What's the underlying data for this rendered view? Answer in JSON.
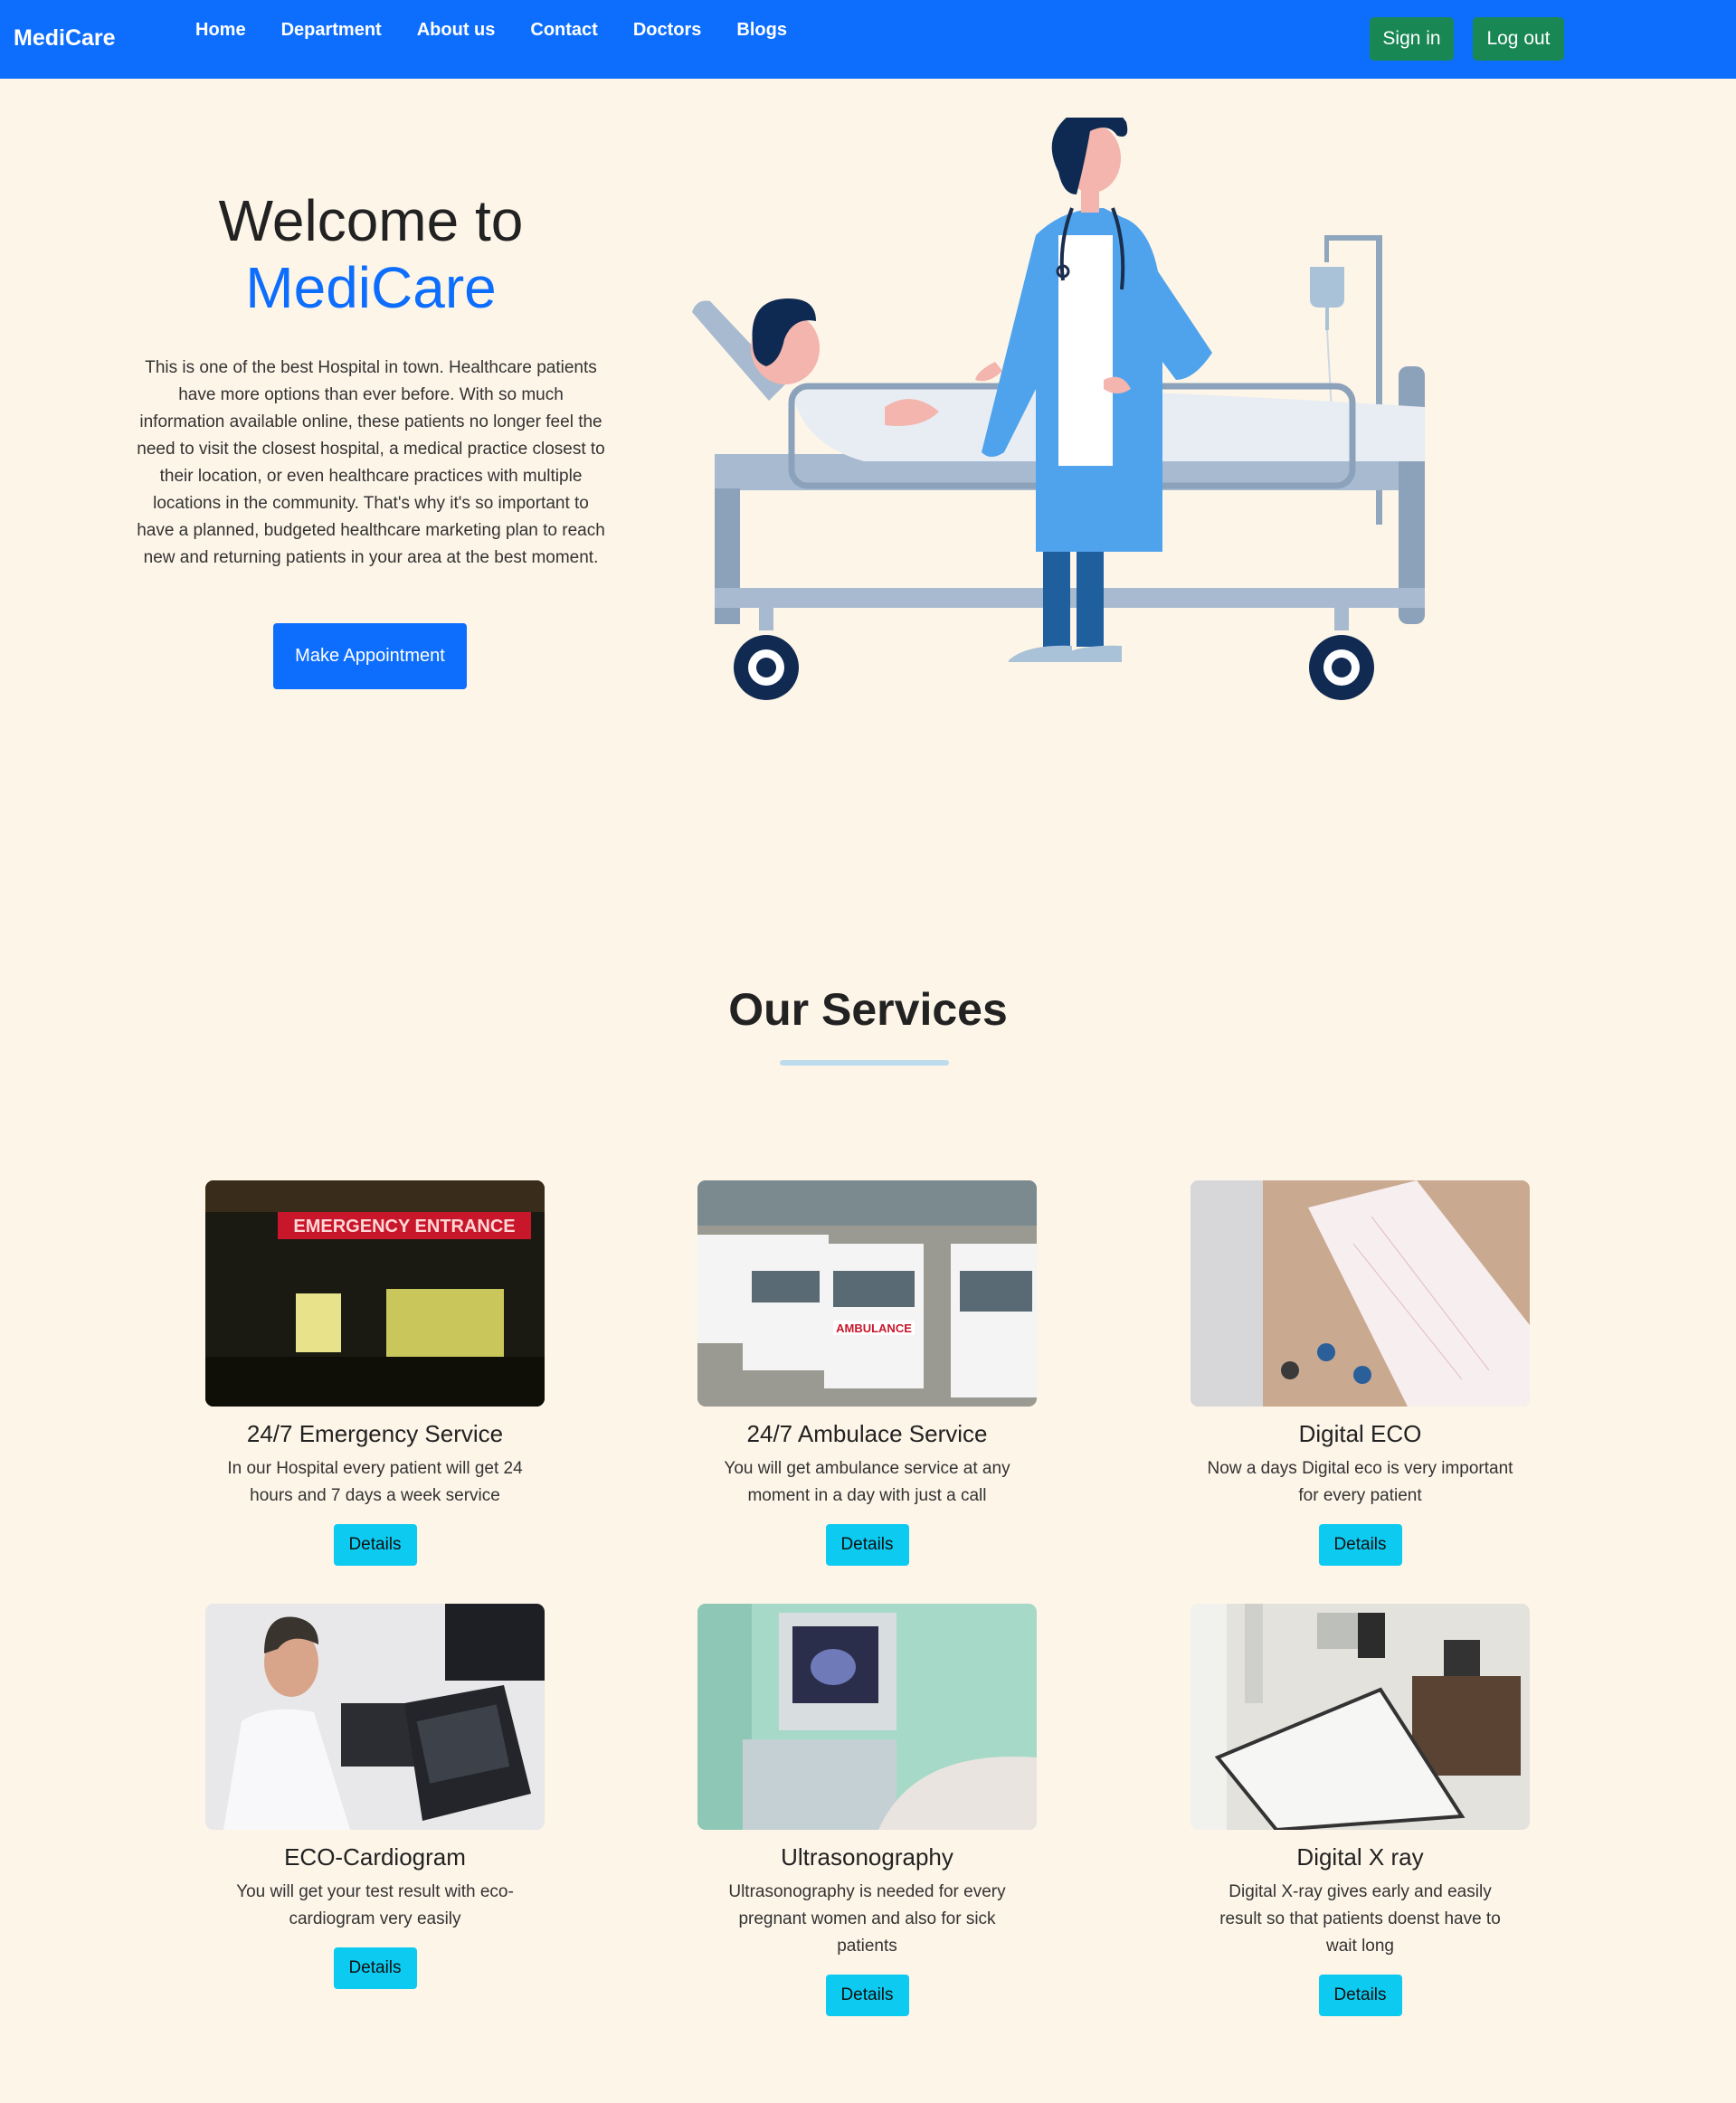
{
  "navbar": {
    "brand": "MediCare",
    "links": [
      "Home",
      "Department",
      "About us",
      "Contact",
      "Doctors",
      "Blogs"
    ],
    "sign_in": "Sign in",
    "log_out": "Log out"
  },
  "hero": {
    "title_line1": "Welcome to",
    "title_line2": "MediCare",
    "description": "This is one of the best Hospital in town. Healthcare patients have more options than ever before. With so much information available online, these patients no longer feel the need to visit the closest hospital, a medical practice closest to their location, or even healthcare practices with multiple locations in the community. That's why it's so important to have a planned, budgeted healthcare marketing plan to reach new and returning patients in your area at the best moment.",
    "button": "Make Appointment"
  },
  "services": {
    "heading": "Our Services",
    "items": [
      {
        "title": "24/7 Emergency Service",
        "desc": "In our Hospital every patient will get 24 hours and 7 days a week service",
        "button": "Details",
        "sign_text": "EMERGENCY ENTRANCE"
      },
      {
        "title": "24/7 Ambulace Service",
        "desc": "You will get ambulance service at any moment in a day with just a call",
        "button": "Details",
        "sign_text": "AMBULANCE"
      },
      {
        "title": "Digital ECO",
        "desc": "Now a days Digital eco is very important for every patient",
        "button": "Details"
      },
      {
        "title": "ECO-Cardiogram",
        "desc": "You will get your test result with eco-cardiogram very easily",
        "button": "Details"
      },
      {
        "title": "Ultrasonography",
        "desc": "Ultrasonography is needed for every pregnant women and also for sick patients",
        "button": "Details"
      },
      {
        "title": "Digital X ray",
        "desc": "Digital X-ray gives early and easily result so that patients doenst have to wait long",
        "button": "Details"
      }
    ]
  },
  "colors": {
    "primary": "#0d6efd",
    "success": "#198754",
    "info": "#0dcaf0",
    "background": "#fdf5e8"
  }
}
